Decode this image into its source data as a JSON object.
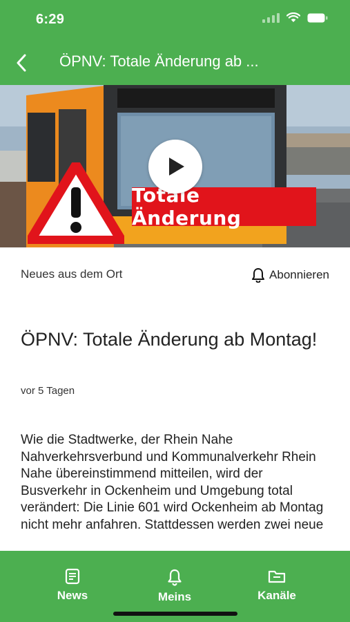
{
  "status_bar": {
    "time": "6:29"
  },
  "header": {
    "title": "ÖPNV: Totale Änderung ab ..."
  },
  "hero": {
    "overlay_text": "Totale Änderung"
  },
  "channel": {
    "name": "Neues aus dem Ort",
    "subscribe_label": "Abonnieren"
  },
  "article": {
    "title": "ÖPNV: Totale Änderung ab Montag!",
    "date": "vor 5 Tagen",
    "body": "Wie die Stadtwerke, der Rhein Nahe Nahverkehrsverbund und Kommunalverkehr Rhein Nahe übereinstimmend mitteilen, wird der Busverkehr in Ockenheim und Umgebung total verändert: Die Linie 601 wird Ockenheim ab Montag nicht mehr anfahren. Stattdessen werden zwei neue"
  },
  "tabbar": {
    "tabs": [
      {
        "label": "News",
        "icon": "newspaper-icon"
      },
      {
        "label": "Meins",
        "icon": "bell-icon"
      },
      {
        "label": "Kanäle",
        "icon": "folder-icon"
      }
    ]
  },
  "colors": {
    "primary": "#4caf50",
    "alert_red": "#e1141b"
  }
}
